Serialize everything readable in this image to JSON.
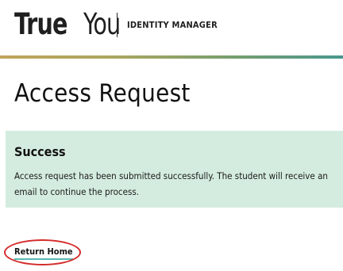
{
  "header": {
    "logo_part1": "True",
    "logo_part2": "You",
    "subtitle": "IDENTITY MANAGER"
  },
  "page": {
    "title": "Access Request"
  },
  "alert": {
    "heading": "Success",
    "message": "Access request has been submitted successfully. The student will receive an email to continue the process."
  },
  "actions": {
    "return_home": "Return Home"
  },
  "colors": {
    "alert_background": "#d4ecdf",
    "link_underline": "#5bb7b3",
    "highlight_ring": "#d42a2a",
    "header_rule_start": "#c1a45a",
    "header_rule_end": "#49978f"
  }
}
